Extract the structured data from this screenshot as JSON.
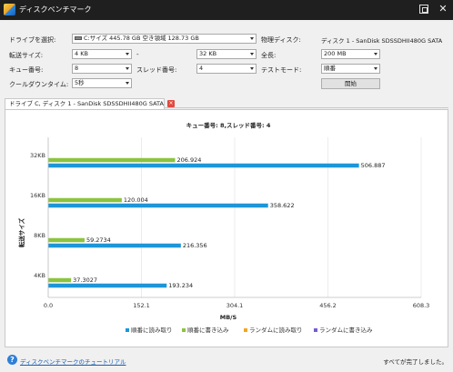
{
  "window": {
    "title": "ディスクベンチマーク",
    "close_glyph": "✕"
  },
  "settings": {
    "drive_label": "ドライブを選択:",
    "drive_value": "C:サイズ 445.78 GB 空き領域 128.73 GB",
    "physical_disk_label": "物理ディスク:",
    "physical_disk_value": "ディスク 1 - SanDisk SDSSDHII480G SATA",
    "transfer_size_label": "転送サイズ:",
    "transfer_size_from": "4 KB",
    "transfer_size_sep": "-",
    "transfer_size_to": "32 KB",
    "total_label": "全長:",
    "total_value": "200 MB",
    "queue_label": "キュー番号:",
    "queue_value": "8",
    "thread_label": "スレッド番号:",
    "thread_value": "4",
    "test_mode_label": "テストモード:",
    "test_mode_value": "順番",
    "cooldown_label": "クールダウンタイム:",
    "cooldown_value": "5秒",
    "start_button": "開始"
  },
  "tab": {
    "label": "ドライブ C, ディスク 1 - SanDisk SDSSDHII480G SATA",
    "close_glyph": "×"
  },
  "chart_data": {
    "type": "bar",
    "orientation": "horizontal",
    "title": "キュー番号: 8,スレッド番号: 4",
    "xlabel": "MB/S",
    "ylabel": "転送サイズ",
    "categories": [
      "32KB",
      "16KB",
      "8KB",
      "4KB"
    ],
    "xlim": [
      0,
      608.3
    ],
    "xticks": [
      "0.0",
      "152.1",
      "304.1",
      "456.2",
      "608.3"
    ],
    "grid": true,
    "legend_position": "bottom",
    "series": [
      {
        "name": "順番に読み取り",
        "color": "#1e96d8",
        "values": [
          506.887,
          358.622,
          216.356,
          193.234
        ],
        "labels": [
          "506.887",
          "358.622",
          "216.356",
          "193.234"
        ]
      },
      {
        "name": "順番に書き込み",
        "color": "#8cc43c",
        "values": [
          206.924,
          120.004,
          59.2734,
          37.3027
        ],
        "labels": [
          "206.924",
          "120.004",
          "59.2734",
          "37.3027"
        ]
      },
      {
        "name": "ランダムに読み取り",
        "color": "#f2a623",
        "values": [],
        "labels": []
      },
      {
        "name": "ランダムに書き込み",
        "color": "#7a5bd0",
        "values": [],
        "labels": []
      }
    ]
  },
  "footer": {
    "help_glyph": "?",
    "help_link": "ディスクベンチマークのチュートリアル",
    "status": "すべてが完了しました。"
  }
}
